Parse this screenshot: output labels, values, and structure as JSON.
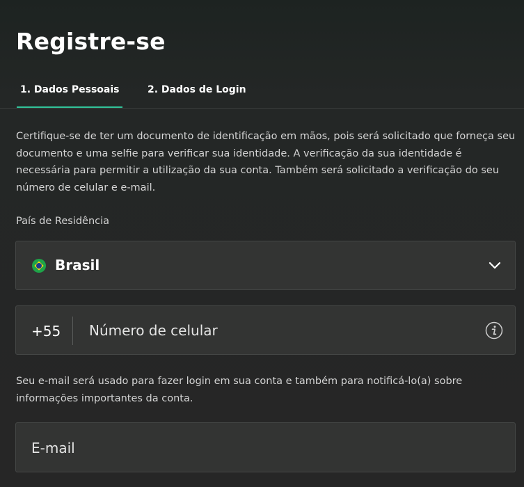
{
  "page": {
    "title": "Registre-se"
  },
  "tabs": [
    {
      "label": "1. Dados Pessoais",
      "active": true
    },
    {
      "label": "2. Dados de Login",
      "active": false
    }
  ],
  "intro_text": "Certifique-se de ter um documento de identificação em mãos, pois será solicitado que forneça seu documento e uma selfie para verificar sua identidade. A verificação da sua identidade é necessária para permitir a utilização da sua conta. Também será solicitado a verificação do seu número de celular e e-mail.",
  "country": {
    "label": "País de Residência",
    "selected": "Brasil",
    "flag_icon": "brazil-flag-icon",
    "dropdown_icon": "chevron-down-icon"
  },
  "phone": {
    "dial_code": "+55",
    "placeholder": "Número de celular",
    "value": "",
    "info_icon": "info-icon"
  },
  "email": {
    "note": "Seu e-mail será usado para fazer login em sua conta e também para notificá-lo(a) sobre informações importantes da conta.",
    "placeholder": "E-mail",
    "value": ""
  },
  "colors": {
    "accent": "#32c49a",
    "field_background": "#333433",
    "text": "#ffffff"
  }
}
